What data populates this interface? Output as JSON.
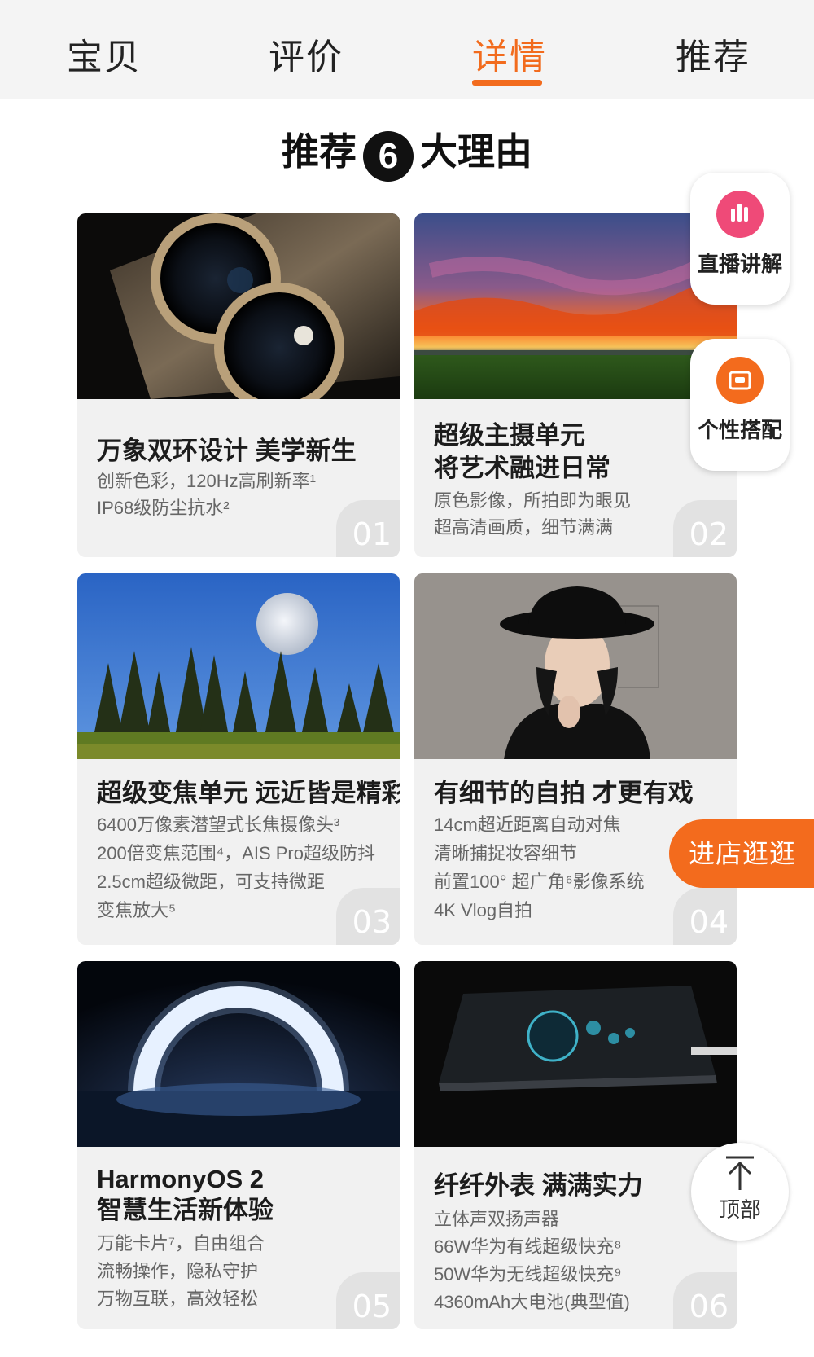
{
  "tabs": [
    {
      "label": "宝贝"
    },
    {
      "label": "评价"
    },
    {
      "label": "详情"
    },
    {
      "label": "推荐"
    }
  ],
  "active_tab": "详情",
  "heading": {
    "before": "推荐",
    "number": "6",
    "after": "大理由"
  },
  "cards": [
    {
      "title": [
        "万象双环设计 美学新生"
      ],
      "desc": [
        "创新色彩，120Hz高刷新率¹",
        "IP68级防尘抗水²"
      ],
      "number": "01",
      "image": "phone-camera-rings"
    },
    {
      "title": [
        "超级主摄单元",
        "将艺术融进日常"
      ],
      "desc": [
        "原色影像，所拍即为眼见",
        "超高清画质，细节满满"
      ],
      "number": "02",
      "image": "sunset-landscape"
    },
    {
      "title": [
        "超级变焦单元 远近皆是精彩"
      ],
      "desc": [
        "6400万像素潜望式长焦摄像头³",
        "200倍变焦范围⁴，AIS Pro超级防抖",
        "2.5cm超级微距，可支持微距",
        "变焦放大⁵"
      ],
      "number": "03",
      "image": "moon-over-forest"
    },
    {
      "title": [
        "有细节的自拍 才更有戏"
      ],
      "desc": [
        "14cm超近距离自动对焦",
        "清晰捕捉妆容细节",
        "前置100° 超广角⁶影像系统",
        "4K Vlog自拍"
      ],
      "number": "04",
      "image": "woman-portrait"
    },
    {
      "title": [
        "HarmonyOS 2",
        "智慧生活新体验"
      ],
      "desc": [
        "万能卡片⁷，自由组合",
        "流畅操作，隐私守护",
        "万物互联，高效轻松"
      ],
      "number": "05",
      "image": "glowing-ring"
    },
    {
      "title": [
        "纤纤外表  满满实力"
      ],
      "desc": [
        "立体声双扬声器",
        "66W华为有线超级快充⁸",
        "50W华为无线超级快充⁹",
        "4360mAh大电池(典型值)"
      ],
      "number": "06",
      "image": "phone-charging"
    }
  ],
  "float": {
    "live": "直播讲解",
    "style": "个性搭配",
    "shop": "进店逛逛",
    "top": "顶部"
  },
  "colors": {
    "accent": "#f26b1d",
    "live_icon": "#ef4a78",
    "style_icon": "#f36b1d"
  },
  "icons": {
    "live": "live-bars-icon",
    "style": "wardrobe-icon",
    "top": "arrow-up-icon"
  }
}
